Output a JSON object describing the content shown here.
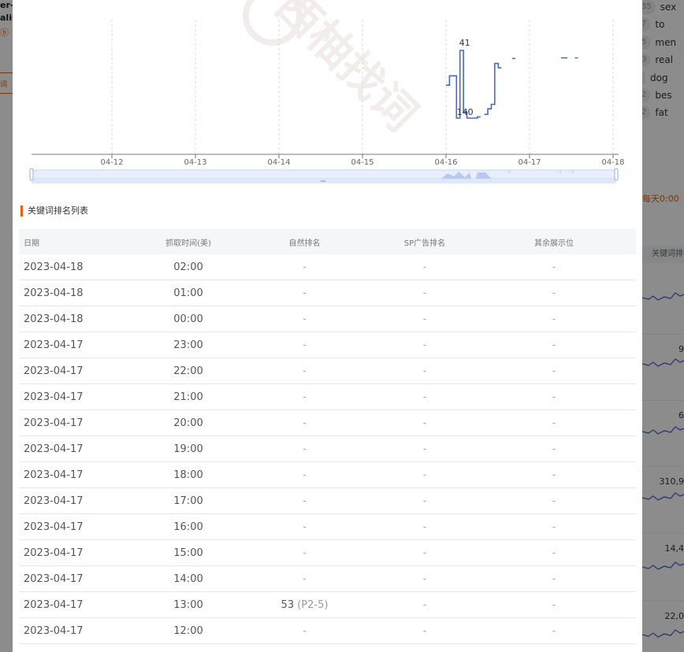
{
  "background": {
    "left_fragments": [
      "er-f",
      "alis",
      "词"
    ],
    "tags": [
      {
        "count": "35",
        "word": "sex"
      },
      {
        "count": "7",
        "word": "to"
      },
      {
        "count": "5",
        "word": "men"
      },
      {
        "count": "3",
        "word": "real"
      },
      {
        "count": "",
        "word": "dog"
      },
      {
        "count": "2",
        "word": "bes"
      },
      {
        "count": "2",
        "word": "fat"
      }
    ],
    "note": "每天0:00",
    "column_header": "关键词排",
    "numbers": [
      "9",
      "6",
      "310,9",
      "14,4",
      "22,0"
    ]
  },
  "chart": {
    "watermark": "西柚找词",
    "point_labels": [
      "41",
      "140"
    ],
    "chart_data": {
      "type": "line",
      "x_ticks": [
        "04-12",
        "04-13",
        "04-14",
        "04-15",
        "04-16",
        "04-17",
        "04-18"
      ],
      "xlabel": "",
      "ylabel": "",
      "y_axis": "inverted rank",
      "grid": true,
      "series": [
        {
          "points": [
            {
              "x": "04-16 00:00",
              "y": 97
            },
            {
              "x": "04-16 01:00",
              "y": 82
            },
            {
              "x": "04-16 02:00",
              "y": 82
            },
            {
              "x": "04-16 03:00",
              "y": 150
            },
            {
              "x": "04-16 04:00",
              "y": 41
            },
            {
              "x": "04-16 05:00",
              "y": 140
            },
            {
              "x": "04-16 06:00",
              "y": 150
            },
            {
              "x": "04-16 07:00",
              "y": 150
            },
            {
              "x": "04-16 08:00",
              "y": 150
            },
            {
              "x": "04-16 09:00",
              "y": 148
            },
            {
              "x": "04-16 10:00",
              "y": null
            },
            {
              "x": "04-16 11:00",
              "y": 144
            },
            {
              "x": "04-16 12:00",
              "y": 135
            },
            {
              "x": "04-16 13:00",
              "y": 128
            },
            {
              "x": "04-16 14:00",
              "y": 62
            },
            {
              "x": "04-16 15:00",
              "y": 69
            },
            {
              "x": "04-16 19:00",
              "y": 54
            },
            {
              "x": "04-17 09:00",
              "y": 53
            },
            {
              "x": "04-17 10:00",
              "y": 53
            },
            {
              "x": "04-17 13:00",
              "y": 53
            }
          ]
        }
      ]
    }
  },
  "section_title": "关键词排名列表",
  "table": {
    "headers": [
      "日期",
      "抓取时间(美)",
      "自然排名",
      "SP广告排名",
      "其余展示位"
    ],
    "rows": [
      [
        "2023-04-18",
        "02:00",
        "-",
        "",
        "-",
        "-"
      ],
      [
        "2023-04-18",
        "01:00",
        "-",
        "",
        "-",
        "-"
      ],
      [
        "2023-04-18",
        "00:00",
        "-",
        "",
        "-",
        "-"
      ],
      [
        "2023-04-17",
        "23:00",
        "-",
        "",
        "-",
        "-"
      ],
      [
        "2023-04-17",
        "22:00",
        "-",
        "",
        "-",
        "-"
      ],
      [
        "2023-04-17",
        "21:00",
        "-",
        "",
        "-",
        "-"
      ],
      [
        "2023-04-17",
        "20:00",
        "-",
        "",
        "-",
        "-"
      ],
      [
        "2023-04-17",
        "19:00",
        "-",
        "",
        "-",
        "-"
      ],
      [
        "2023-04-17",
        "18:00",
        "-",
        "",
        "-",
        "-"
      ],
      [
        "2023-04-17",
        "17:00",
        "-",
        "",
        "-",
        "-"
      ],
      [
        "2023-04-17",
        "16:00",
        "-",
        "",
        "-",
        "-"
      ],
      [
        "2023-04-17",
        "15:00",
        "-",
        "",
        "-",
        "-"
      ],
      [
        "2023-04-17",
        "14:00",
        "-",
        "",
        "-",
        "-"
      ],
      [
        "2023-04-17",
        "13:00",
        "53",
        "(P2-5)",
        "-",
        "-"
      ],
      [
        "2023-04-17",
        "12:00",
        "-",
        "",
        "-",
        "-"
      ]
    ]
  },
  "colors": {
    "accent": "#e8600a",
    "line": "#4a68c8",
    "slider_fill": "#d6e4ff"
  }
}
